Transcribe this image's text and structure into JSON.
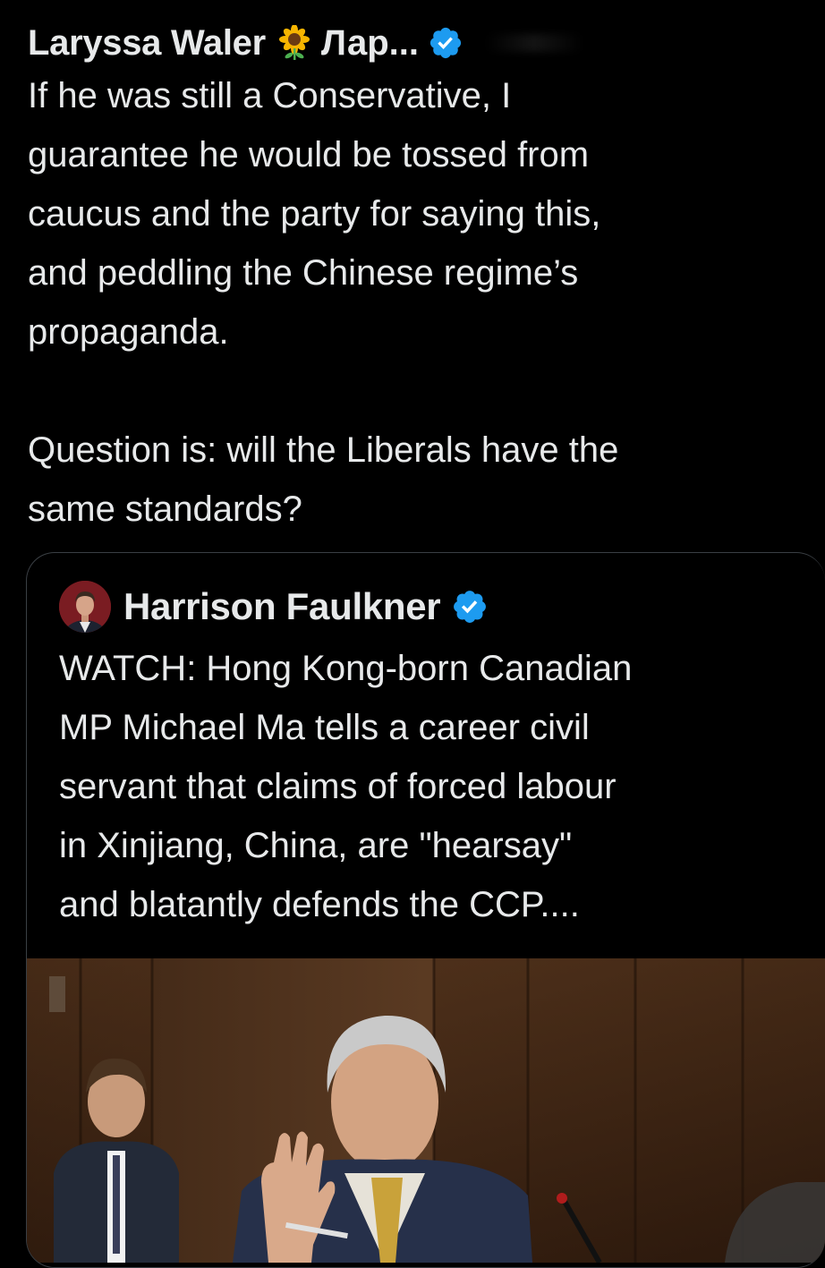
{
  "tweet": {
    "author_name": "Laryssa Waler",
    "author_emoji": "sunflower-icon",
    "author_name_cont": "Лар...",
    "text": "If he was still a Conservative, I\nguarantee he would be tossed from\ncaucus and the party for saying this,\nand peddling the Chinese regime’s\npropaganda.\n\nQuestion is: will the Liberals have the\nsame standards?"
  },
  "quoted_tweet": {
    "author_name": "Harrison Faulkner",
    "text_lines": [
      "WATCH: Hong Kong-born Canadian",
      "MP Michael Ma tells a career civil",
      "servant that claims of forced labour",
      "in Xinjiang, China, are \"hearsay\"",
      "and blatantly defends the CCP...."
    ]
  },
  "colors": {
    "background": "#000000",
    "text": "#e7e9ea",
    "verified": "#1d9bf0",
    "border": "#3a3f44"
  }
}
